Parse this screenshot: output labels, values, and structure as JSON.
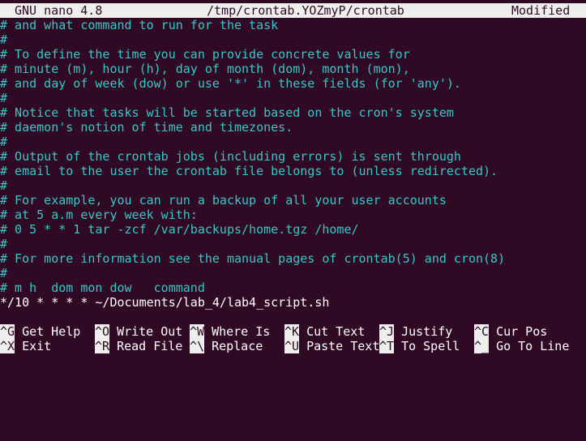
{
  "titlebar": {
    "app": "GNU nano 4.8",
    "file": "/tmp/crontab.YOZmyP/crontab",
    "status": "Modified"
  },
  "lines": [
    "# and what command to run for the task",
    "#",
    "# To define the time you can provide concrete values for",
    "# minute (m), hour (h), day of month (dom), month (mon),",
    "# and day of week (dow) or use '*' in these fields (for 'any').",
    "#",
    "# Notice that tasks will be started based on the cron's system",
    "# daemon's notion of time and timezones.",
    "#",
    "# Output of the crontab jobs (including errors) is sent through",
    "# email to the user the crontab file belongs to (unless redirected).",
    "#",
    "# For example, you can run a backup of all your user accounts",
    "# at 5 a.m every week with:",
    "# 0 5 * * 1 tar -zcf /var/backups/home.tgz /home/",
    "#",
    "# For more information see the manual pages of crontab(5) and cron(8)",
    "#",
    "# m h  dom mon dow   command",
    "*/10 * * * * ~/Documents/lab_4/lab4_script.sh"
  ],
  "shortcuts_row1": [
    {
      "key": "^G",
      "label": "Get Help"
    },
    {
      "key": "^O",
      "label": "Write Out"
    },
    {
      "key": "^W",
      "label": "Where Is"
    },
    {
      "key": "^K",
      "label": "Cut Text"
    },
    {
      "key": "^J",
      "label": "Justify"
    },
    {
      "key": "^C",
      "label": "Cur Pos"
    }
  ],
  "shortcuts_row2": [
    {
      "key": "^X",
      "label": "Exit"
    },
    {
      "key": "^R",
      "label": "Read File"
    },
    {
      "key": "^\\",
      "label": "Replace"
    },
    {
      "key": "^U",
      "label": "Paste Text"
    },
    {
      "key": "^T",
      "label": "To Spell"
    },
    {
      "key": "^_",
      "label": "Go To Line"
    }
  ],
  "colors": {
    "background": "#300a24",
    "comment": "#34c9c6",
    "text": "#ffffff",
    "bar": "#eeeeec"
  }
}
